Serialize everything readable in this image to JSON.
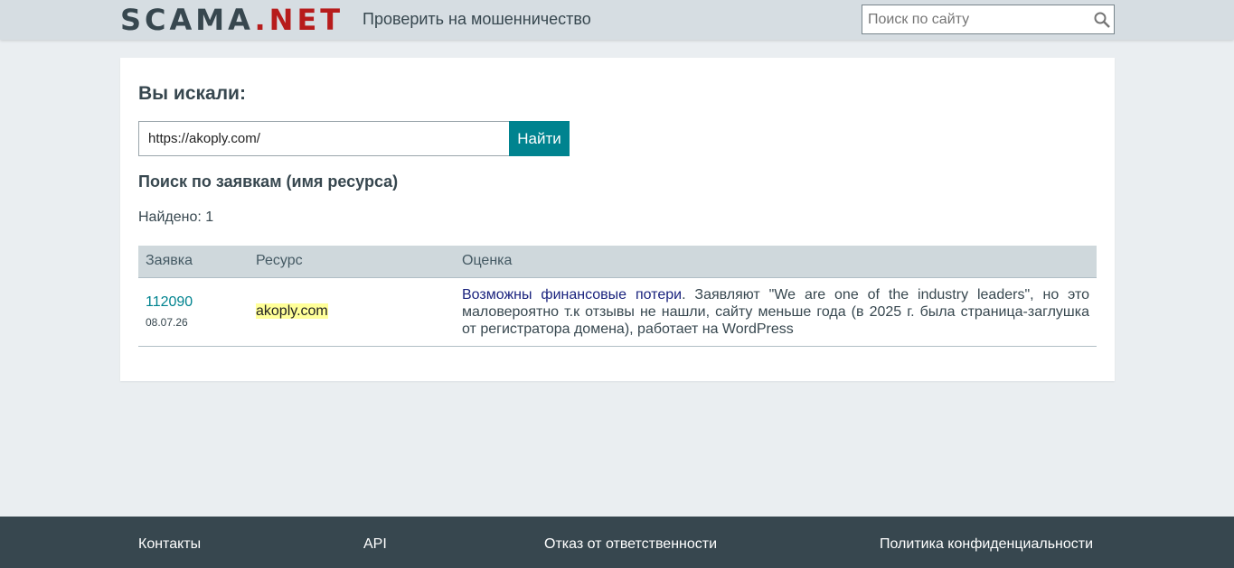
{
  "header": {
    "logo_main": "SCAMA",
    "logo_accent": ".NET",
    "nav_check": "Проверить на мошенничество",
    "search_placeholder": "Поиск по сайту"
  },
  "main": {
    "title": "Вы искали:",
    "query_value": "https://akoply.com/",
    "find_button": "Найти",
    "section_title": "Поиск по заявкам (имя ресурса)",
    "found_text": "Найдено: 1",
    "table": {
      "columns": [
        "Заявка",
        "Ресурс",
        "Оценка"
      ],
      "rows": [
        {
          "request_id": "112090",
          "date": "08.07.26",
          "resource": "akoply.com",
          "rating_link": "Возможны финансовые потери",
          "rating_text": ". Заявляют \"We are one of the industry leaders\", но это маловероятно т.к отзывы не нашли, сайту меньше года (в 2025 г. была страница-заглушка от регистратора домена), работает на WordPress"
        }
      ]
    }
  },
  "footer": {
    "contacts": "Контакты",
    "api": "API",
    "disclaimer": "Отказ от ответственности",
    "privacy": "Политика конфиденциальности"
  },
  "colors": {
    "accent": "#00838f",
    "logo_accent": "#b71c1c",
    "footer_bg": "#37474f",
    "highlight": "#ffff99"
  }
}
